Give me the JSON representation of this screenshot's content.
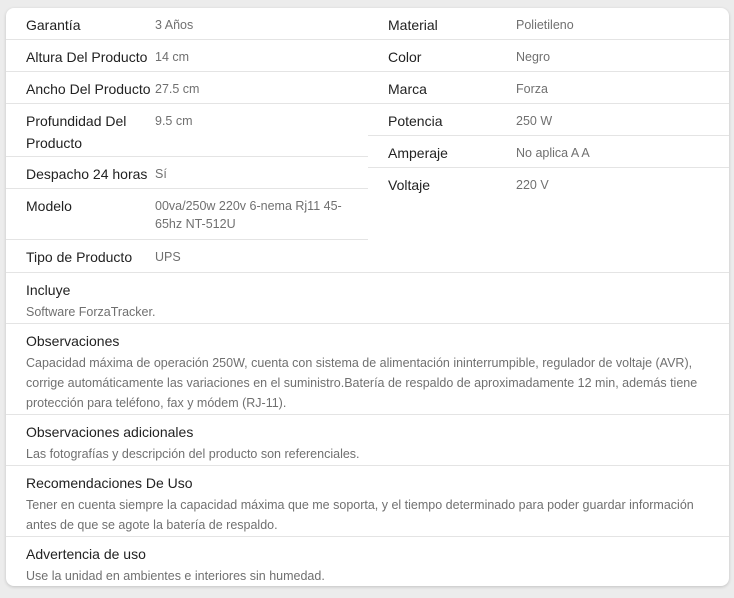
{
  "left_rows": [
    {
      "label": "Garantía",
      "value": "3 Años"
    },
    {
      "label": "Altura Del Producto",
      "value": "14 cm"
    },
    {
      "label": "Ancho Del Producto",
      "value": "27.5 cm"
    },
    {
      "label": "Profundidad Del Producto",
      "value": "9.5 cm"
    },
    {
      "label": "Despacho 24 horas",
      "value": "Sí"
    },
    {
      "label": "Modelo",
      "value": "00va/250w 220v 6-nema Rj11 45-65hz NT-512U"
    },
    {
      "label": "Tipo de Producto",
      "value": "UPS"
    }
  ],
  "right_rows": [
    {
      "label": "Material",
      "value": "Polietileno"
    },
    {
      "label": "Color",
      "value": "Negro"
    },
    {
      "label": "Marca",
      "value": "Forza"
    },
    {
      "label": "Potencia",
      "value": "250 W"
    },
    {
      "label": "Amperaje",
      "value": "No aplica A A"
    },
    {
      "label": "Voltaje",
      "value": "220 V"
    }
  ],
  "full_rows": [
    {
      "label": "Incluye",
      "value": "Software ForzaTracker."
    },
    {
      "label": "Observaciones",
      "value": "Capacidad máxima de operación 250W, cuenta con sistema de alimentación ininterrumpible, regulador de voltaje (AVR), corrige automáticamente las variaciones en el suministro.Batería de respaldo de aproximadamente 12 min, además tiene protección para teléfono, fax y módem (RJ-11)."
    },
    {
      "label": "Observaciones adicionales",
      "value": "Las fotografías y descripción del producto son referenciales."
    },
    {
      "label": "Recomendaciones De Uso",
      "value": "Tener en cuenta siempre la capacidad máxima que me soporta, y el tiempo determinado para poder guardar información antes de que se agote la batería de respaldo."
    },
    {
      "label": "Advertencia de uso",
      "value": "Use la unidad en ambientes e interiores sin humedad."
    }
  ]
}
